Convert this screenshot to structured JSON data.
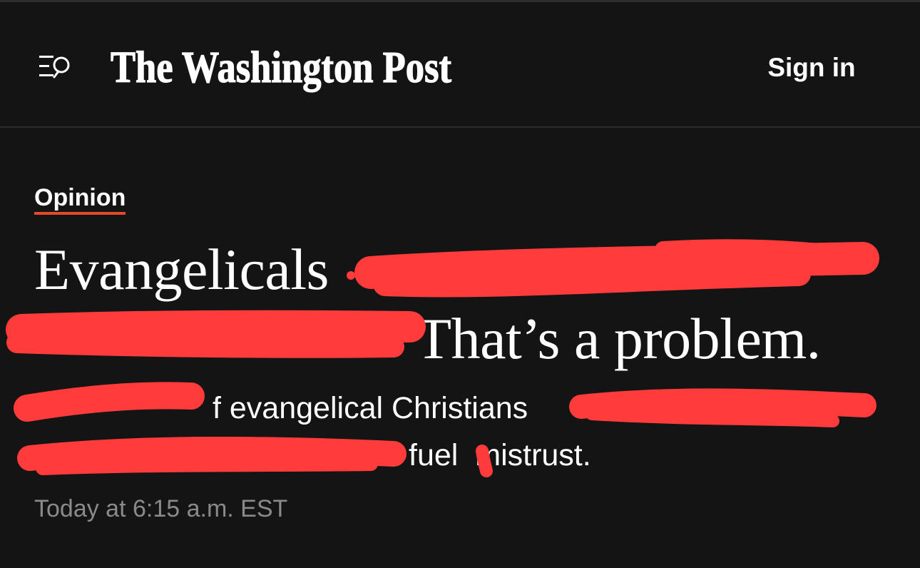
{
  "header": {
    "masthead": "The Washington Post",
    "menu_search_icon": "menu-search-icon",
    "sign_in_label": "Sign in"
  },
  "article": {
    "kicker": "Opinion",
    "headline_line1": "Evangelicals",
    "headline_line2": "That’s a problem.",
    "dek_line1": "f evangelical Christians",
    "dek_line2_a": "fuel",
    "dek_line2_b": "mistrust.",
    "timestamp": "Today at 6:15 a.m. EST"
  },
  "colors": {
    "background": "#141414",
    "text": "#ffffff",
    "kicker_underline": "#e9492b",
    "timestamp": "#8a8a8a",
    "redaction": "#ff3b3b"
  }
}
